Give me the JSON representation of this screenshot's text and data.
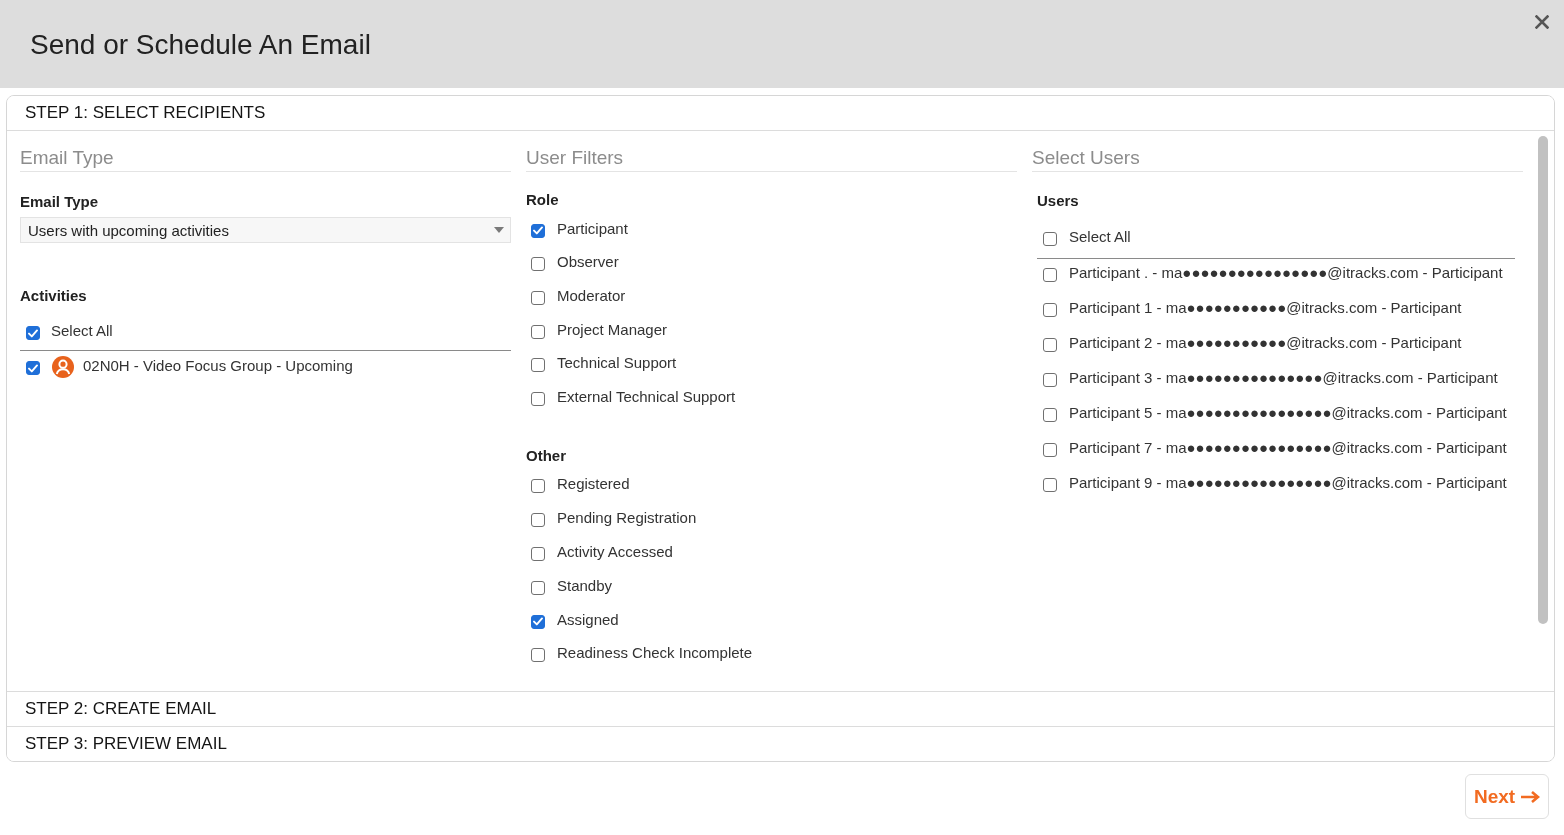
{
  "dialog": {
    "title": "Send or Schedule An Email"
  },
  "steps": [
    {
      "label": "STEP 1: SELECT RECIPIENTS",
      "expanded": true
    },
    {
      "label": "STEP 2: CREATE EMAIL",
      "expanded": false
    },
    {
      "label": "STEP 3: PREVIEW EMAIL",
      "expanded": false
    }
  ],
  "email_type_section": {
    "heading": "Email Type",
    "field_label": "Email Type",
    "value": "Users with upcoming activities",
    "activities_label": "Activities",
    "select_all": {
      "label": "Select All",
      "checked": true
    },
    "activities": [
      {
        "label": "02N0H - Video Focus Group - Upcoming",
        "checked": true
      }
    ]
  },
  "user_filters": {
    "heading": "User Filters",
    "groups": [
      {
        "label": "Role",
        "options": [
          {
            "label": "Participant",
            "checked": true
          },
          {
            "label": "Observer",
            "checked": false
          },
          {
            "label": "Moderator",
            "checked": false
          },
          {
            "label": "Project Manager",
            "checked": false
          },
          {
            "label": "Technical Support",
            "checked": false
          },
          {
            "label": "External Technical Support",
            "checked": false
          }
        ]
      },
      {
        "label": "Other",
        "options": [
          {
            "label": "Registered",
            "checked": false
          },
          {
            "label": "Pending Registration",
            "checked": false
          },
          {
            "label": "Activity Accessed",
            "checked": false
          },
          {
            "label": "Standby",
            "checked": false
          },
          {
            "label": "Assigned",
            "checked": true
          },
          {
            "label": "Readiness Check Incomplete",
            "checked": false
          }
        ]
      }
    ]
  },
  "select_users": {
    "heading": "Select Users",
    "label": "Users",
    "select_all": {
      "label": "Select All",
      "checked": false
    },
    "users": [
      {
        "label": "Participant . - ma●●●●●●●●●●●●●●●●@itracks.com - Participant",
        "checked": false
      },
      {
        "label": "Participant 1 - ma●●●●●●●●●●●@itracks.com - Participant",
        "checked": false
      },
      {
        "label": "Participant 2 - ma●●●●●●●●●●●@itracks.com - Participant",
        "checked": false
      },
      {
        "label": "Participant 3 - ma●●●●●●●●●●●●●●●@itracks.com - Participant",
        "checked": false
      },
      {
        "label": "Participant 5 - ma●●●●●●●●●●●●●●●●@itracks.com - Participant",
        "checked": false
      },
      {
        "label": "Participant 7 - ma●●●●●●●●●●●●●●●●@itracks.com - Participant",
        "checked": false
      },
      {
        "label": "Participant 9 - ma●●●●●●●●●●●●●●●●@itracks.com - Participant",
        "checked": false
      }
    ]
  },
  "footer": {
    "next_button": "Next"
  }
}
